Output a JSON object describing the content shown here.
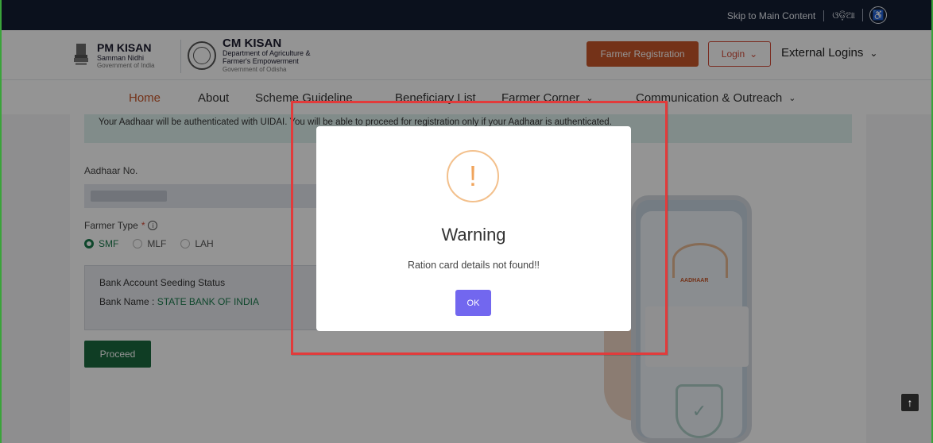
{
  "topbar": {
    "skip_link": "Skip to Main Content",
    "language": "ଓଡ଼ିଆ",
    "accessibility_icon": "accessibility-icon"
  },
  "header": {
    "pm_kisan": {
      "title": "PM KISAN",
      "line2": "Samman Nidhi",
      "line3": "Government of India"
    },
    "cm_kisan": {
      "title": "CM KISAN",
      "line2": "Department of Agriculture &",
      "line3": "Farmer's Empowerment",
      "line4": "Government of Odisha"
    },
    "farmer_registration": "Farmer Registration",
    "login": "Login",
    "external_logins": "External Logins"
  },
  "nav": {
    "items": [
      {
        "label": "Home",
        "active": true
      },
      {
        "label": "About"
      },
      {
        "label": "Scheme Guideline"
      },
      {
        "label": "Beneficiary List"
      },
      {
        "label": "Farmer Corner",
        "dropdown": true
      },
      {
        "label": "Communication & Outreach",
        "dropdown": true
      }
    ]
  },
  "form": {
    "notice": "Your Aadhaar will be authenticated with UIDAI. You will be able to proceed for registration only if your Aadhaar is authenticated.",
    "aadhaar_label": "Aadhaar No.",
    "farmer_type_label": "Farmer Type",
    "farmer_type_required": "*",
    "farmer_types": [
      "SMF",
      "MLF",
      "LAH"
    ],
    "selected_farmer_type": "SMF",
    "bank_status_title": "Bank Account Seeding Status",
    "bank_name_label": "Bank Name : ",
    "bank_name_value": "STATE BANK OF INDIA",
    "proceed": "Proceed"
  },
  "illustration": {
    "aadhaar_text": "AADHAAR"
  },
  "modal": {
    "icon": "warning-icon",
    "icon_glyph": "!",
    "title": "Warning",
    "message": "Ration card details not found!!",
    "ok": "OK"
  },
  "colors": {
    "topbar_bg": "#141e33",
    "accent_orange": "#c8562a",
    "primary_green": "#1b6a3e",
    "ok_button": "#7267ef",
    "annotation_red": "#e23b3b"
  }
}
